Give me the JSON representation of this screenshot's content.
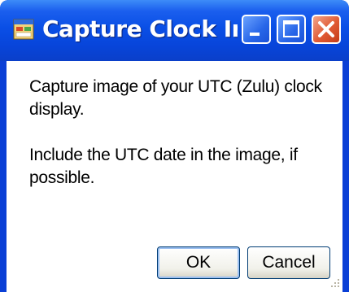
{
  "window": {
    "title": "Capture Clock Im...",
    "app_icon": "form-icon",
    "controls": [
      "minimize-icon",
      "maximize-icon",
      "close-icon"
    ]
  },
  "message": {
    "line1": "Capture image of your UTC (Zulu) clock display.",
    "line2": "Include the UTC date in the image, if possible."
  },
  "buttons": {
    "ok_label": "OK",
    "cancel_label": "Cancel"
  },
  "colors": {
    "titlebar": "#0a4fe6",
    "close_button": "#e05a34",
    "background": "#ffffff"
  }
}
